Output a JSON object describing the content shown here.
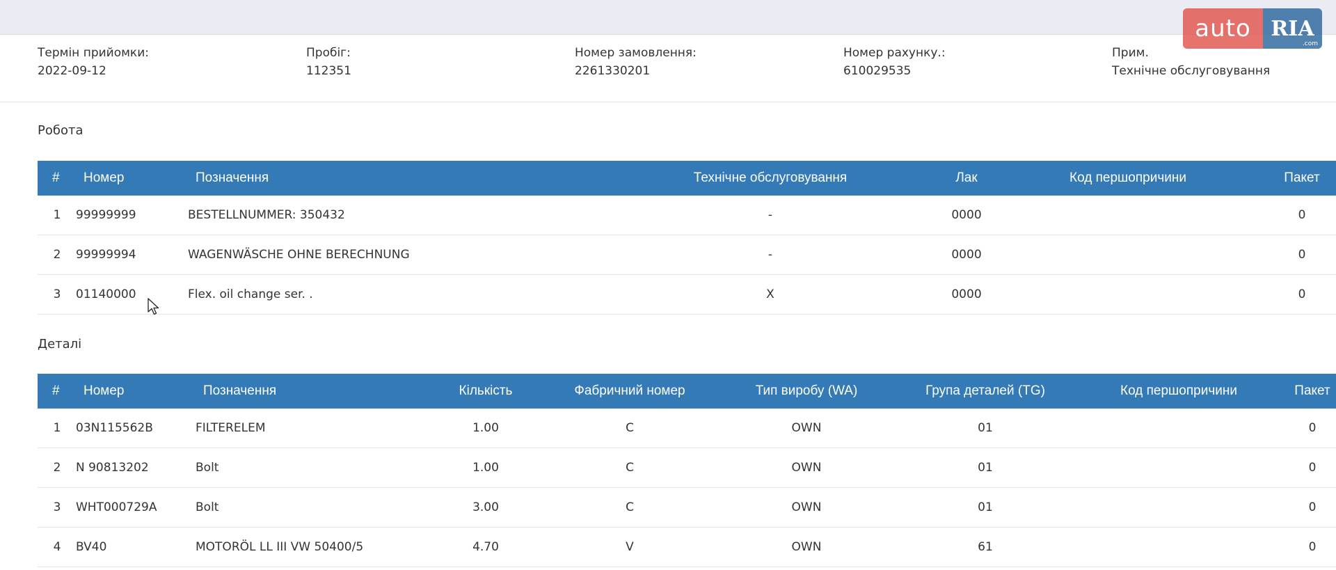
{
  "watermark": {
    "left": "auto",
    "right": "RIA",
    "suffix": ".com"
  },
  "info": [
    {
      "label": "Термін прийомки:",
      "value": "2022-09-12"
    },
    {
      "label": "Пробіг:",
      "value": "112351"
    },
    {
      "label": "Номер замовлення:",
      "value": "2261330201"
    },
    {
      "label": "Номер рахунку.:",
      "value": "610029535"
    },
    {
      "label": "Прим.",
      "value": "Технічне обслуговування"
    }
  ],
  "work": {
    "title": "Робота",
    "headers": [
      "#",
      "Номер",
      "Позначення",
      "Технічне обслуговування",
      "Лак",
      "Код першопричини",
      "Пакет"
    ],
    "rows": [
      {
        "n": "1",
        "number": "99999999",
        "designation": "BESTELLNUMMER: 350432",
        "maintenance": "-",
        "lak": "0000",
        "cause": "",
        "packet": "0"
      },
      {
        "n": "2",
        "number": "99999994",
        "designation": "WAGENWÄSCHE OHNE BERECHNUNG",
        "maintenance": "-",
        "lak": "0000",
        "cause": "",
        "packet": "0"
      },
      {
        "n": "3",
        "number": "01140000",
        "designation": "Flex. oil change ser. .",
        "maintenance": "X",
        "lak": "0000",
        "cause": "",
        "packet": "0"
      }
    ]
  },
  "parts": {
    "title": "Деталі",
    "headers": [
      "#",
      "Номер",
      "Позначення",
      "Кількість",
      "Фабричний номер",
      "Тип виробу (WA)",
      "Група деталей (TG)",
      "Код першопричини",
      "Пакет"
    ],
    "rows": [
      {
        "n": "1",
        "number": "03N115562B",
        "designation": "FILTERELEM",
        "qty": "1.00",
        "factory": "C",
        "type": "OWN",
        "group": "01",
        "cause": "",
        "packet": "0"
      },
      {
        "n": "2",
        "number": "N 90813202",
        "designation": "Bolt",
        "qty": "1.00",
        "factory": "C",
        "type": "OWN",
        "group": "01",
        "cause": "",
        "packet": "0"
      },
      {
        "n": "3",
        "number": "WHT000729A",
        "designation": "Bolt",
        "qty": "3.00",
        "factory": "C",
        "type": "OWN",
        "group": "01",
        "cause": "",
        "packet": "0"
      },
      {
        "n": "4",
        "number": "BV40",
        "designation": "MOTORÖL LL III VW 50400/5",
        "qty": "4.70",
        "factory": "V",
        "type": "OWN",
        "group": "61",
        "cause": "",
        "packet": "0"
      }
    ]
  }
}
